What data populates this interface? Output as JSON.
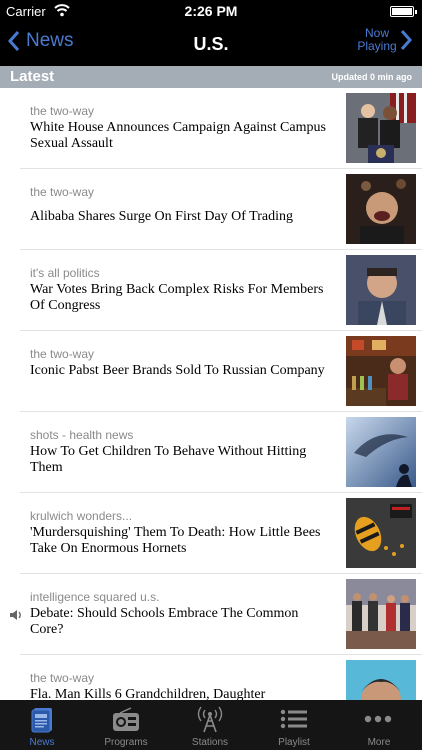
{
  "status_bar": {
    "carrier": "Carrier",
    "time": "2:26 PM"
  },
  "nav": {
    "back_label": "News",
    "title": "U.S.",
    "now_playing_line1": "Now",
    "now_playing_line2": "Playing"
  },
  "section": {
    "title": "Latest",
    "updated": "Updated 0 min ago"
  },
  "stories": [
    {
      "category": "the two-way",
      "headline": "White House Announces Campaign Against Campus Sexual Assault"
    },
    {
      "category": "the two-way",
      "headline": "Alibaba Shares Surge On First Day Of Trading"
    },
    {
      "category": "it's all politics",
      "headline": "War Votes Bring Back Complex Risks For Members Of Congress"
    },
    {
      "category": "the two-way",
      "headline": "Iconic Pabst Beer Brands Sold To Russian Company"
    },
    {
      "category": "shots - health news",
      "headline": "How To Get Children To Behave Without Hitting Them"
    },
    {
      "category": "krulwich wonders...",
      "headline": "'Murdersquishing' Them To Death: How Little Bees Take On Enormous Hornets"
    },
    {
      "category": "intelligence squared u.s.",
      "headline": "Debate: Should Schools Embrace The Common Core?"
    },
    {
      "category": "the two-way",
      "headline": "Fla. Man Kills 6 Grandchildren, Daughter"
    }
  ],
  "tabs": [
    {
      "label": "News",
      "icon": "news-icon"
    },
    {
      "label": "Programs",
      "icon": "radio-icon"
    },
    {
      "label": "Stations",
      "icon": "antenna-icon"
    },
    {
      "label": "Playlist",
      "icon": "list-icon"
    },
    {
      "label": "More",
      "icon": "more-dots-icon"
    }
  ],
  "colors": {
    "accent": "#4a7bd1",
    "section_header": "#a4adb5",
    "category_text": "#8a8a8a",
    "tab_bar": "#151515"
  }
}
